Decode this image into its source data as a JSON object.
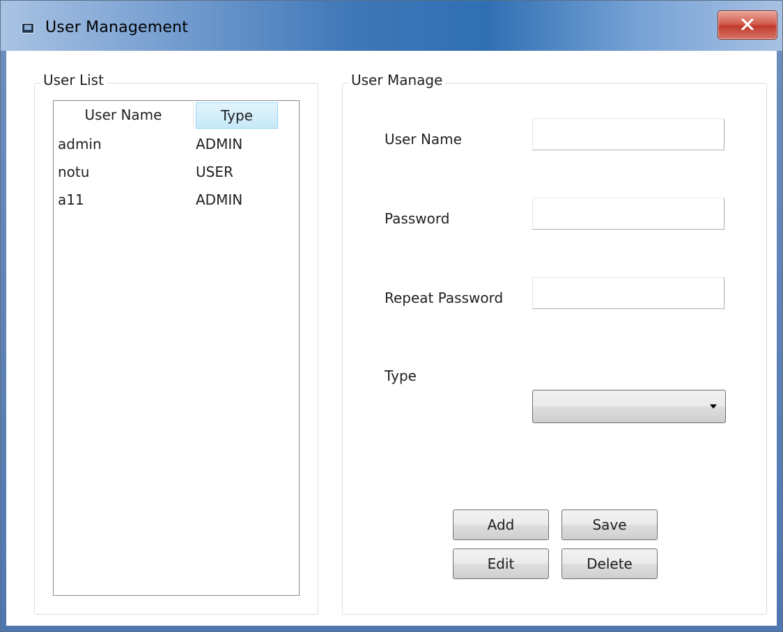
{
  "window": {
    "title": "User Management",
    "close_icon": "close-icon"
  },
  "user_list": {
    "group_label": "User List",
    "columns": [
      "User Name",
      "Type"
    ],
    "rows": [
      {
        "name": "admin",
        "type": "ADMIN"
      },
      {
        "name": "notu",
        "type": "USER"
      },
      {
        "name": "a11",
        "type": "ADMIN"
      }
    ]
  },
  "user_manage": {
    "group_label": "User Manage",
    "fields": {
      "user_name": {
        "label": "User Name",
        "value": ""
      },
      "password": {
        "label": "Password",
        "value": ""
      },
      "repeat_password": {
        "label": "Repeat Password",
        "value": ""
      },
      "type": {
        "label": "Type",
        "selected": ""
      }
    },
    "buttons": {
      "add": "Add",
      "save": "Save",
      "edit": "Edit",
      "delete": "Delete"
    }
  },
  "colors": {
    "title_gradient_mid": "#2f6fb3",
    "close_button": "#c0392b",
    "selected_header": "#c6e8f8",
    "group_border": "#d5dfe5"
  }
}
